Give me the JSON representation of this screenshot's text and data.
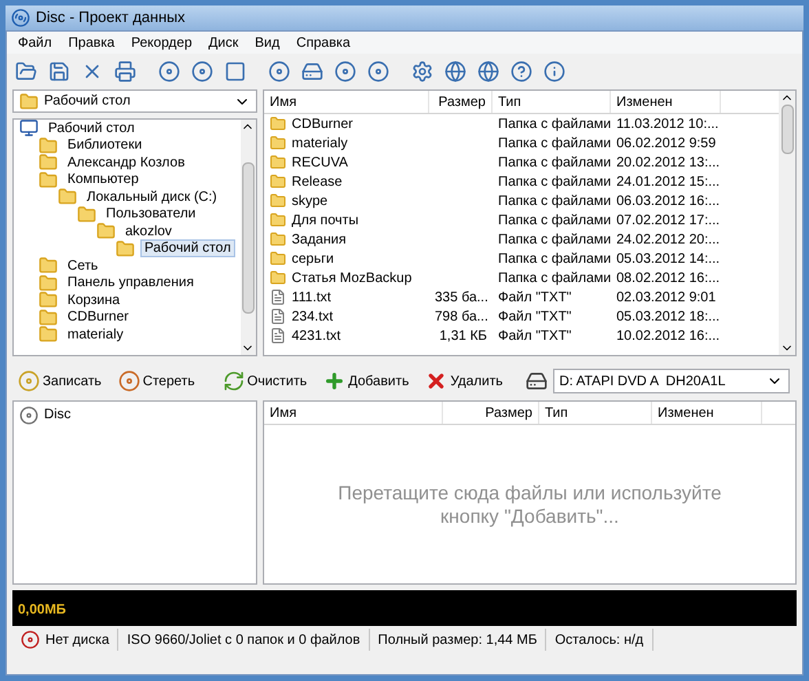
{
  "window": {
    "title": "Disc - Проект данных"
  },
  "menu": [
    "Файл",
    "Правка",
    "Рекордер",
    "Диск",
    "Вид",
    "Справка"
  ],
  "location": {
    "value": "Рабочий стол"
  },
  "tree": [
    {
      "label": "Рабочий стол",
      "selected": false,
      "children": [
        {
          "label": "Библиотеки",
          "selected": false
        },
        {
          "label": "Александр Козлов",
          "selected": false
        },
        {
          "label": "Компьютер",
          "selected": false,
          "children": [
            {
              "label": "Локальный диск (C:)",
              "selected": false,
              "children": [
                {
                  "label": "Пользователи",
                  "selected": false,
                  "children": [
                    {
                      "label": "akozlov",
                      "selected": false,
                      "children": [
                        {
                          "label": "Рабочий стол",
                          "selected": true
                        }
                      ]
                    }
                  ]
                }
              ]
            }
          ]
        },
        {
          "label": "Сеть",
          "selected": false
        },
        {
          "label": "Панель управления",
          "selected": false
        },
        {
          "label": "Корзина",
          "selected": false
        },
        {
          "label": "CDBurner",
          "selected": false
        },
        {
          "label": "materialy",
          "selected": false
        }
      ]
    }
  ],
  "files": {
    "columns": [
      "Имя",
      "Размер",
      "Тип",
      "Изменен"
    ],
    "rows": [
      {
        "kind": "folder",
        "name": "CDBurner",
        "size": "",
        "type": "Папка с файлами",
        "modified": "11.03.2012 10:..."
      },
      {
        "kind": "folder",
        "name": "materialy",
        "size": "",
        "type": "Папка с файлами",
        "modified": "06.02.2012 9:59"
      },
      {
        "kind": "folder",
        "name": "RECUVA",
        "size": "",
        "type": "Папка с файлами",
        "modified": "20.02.2012 13:..."
      },
      {
        "kind": "folder",
        "name": "Release",
        "size": "",
        "type": "Папка с файлами",
        "modified": "24.01.2012 15:..."
      },
      {
        "kind": "folder",
        "name": "skype",
        "size": "",
        "type": "Папка с файлами",
        "modified": "06.03.2012 16:..."
      },
      {
        "kind": "folder",
        "name": "Для почты",
        "size": "",
        "type": "Папка с файлами",
        "modified": "07.02.2012 17:..."
      },
      {
        "kind": "folder",
        "name": "Задания",
        "size": "",
        "type": "Папка с файлами",
        "modified": "24.02.2012 20:..."
      },
      {
        "kind": "folder",
        "name": "серьги",
        "size": "",
        "type": "Папка с файлами",
        "modified": "05.03.2012 14:..."
      },
      {
        "kind": "folder",
        "name": "Статья MozBackup",
        "size": "",
        "type": "Папка с файлами",
        "modified": "08.02.2012 16:..."
      },
      {
        "kind": "file",
        "name": "111.txt",
        "size": "335 ба...",
        "type": "Файл \"TXT\"",
        "modified": "02.03.2012 9:01"
      },
      {
        "kind": "file",
        "name": "234.txt",
        "size": "798 ба...",
        "type": "Файл \"TXT\"",
        "modified": "05.03.2012 18:..."
      },
      {
        "kind": "file",
        "name": "4231.txt",
        "size": "1,31 КБ",
        "type": "Файл \"TXT\"",
        "modified": "10.02.2012 16:..."
      }
    ]
  },
  "actions": [
    {
      "kind": "burn",
      "label": "Записать"
    },
    {
      "kind": "erase",
      "label": "Стереть"
    },
    {
      "kind": "clear",
      "label": "Очистить"
    },
    {
      "kind": "add",
      "label": "Добавить"
    },
    {
      "kind": "remove",
      "label": "Удалить"
    }
  ],
  "drive": {
    "value": "D: ATAPI DVD A  DH20A1L"
  },
  "project_tree": [
    {
      "label": "Disc",
      "selected": false
    }
  ],
  "project_files": {
    "columns": [
      "Имя",
      "Размер",
      "Тип",
      "Изменен"
    ],
    "hint": "Перетащите сюда файлы или используйте кнопку \"Добавить\"..."
  },
  "capacity": {
    "reading": "0,00МБ",
    "level": 0
  },
  "status_bar": [
    "Нет диска",
    "ISO 9660/Joliet с 0 папок и 0 файлов",
    "Полный размер: 1,44 МБ",
    "Осталось: н/д"
  ]
}
